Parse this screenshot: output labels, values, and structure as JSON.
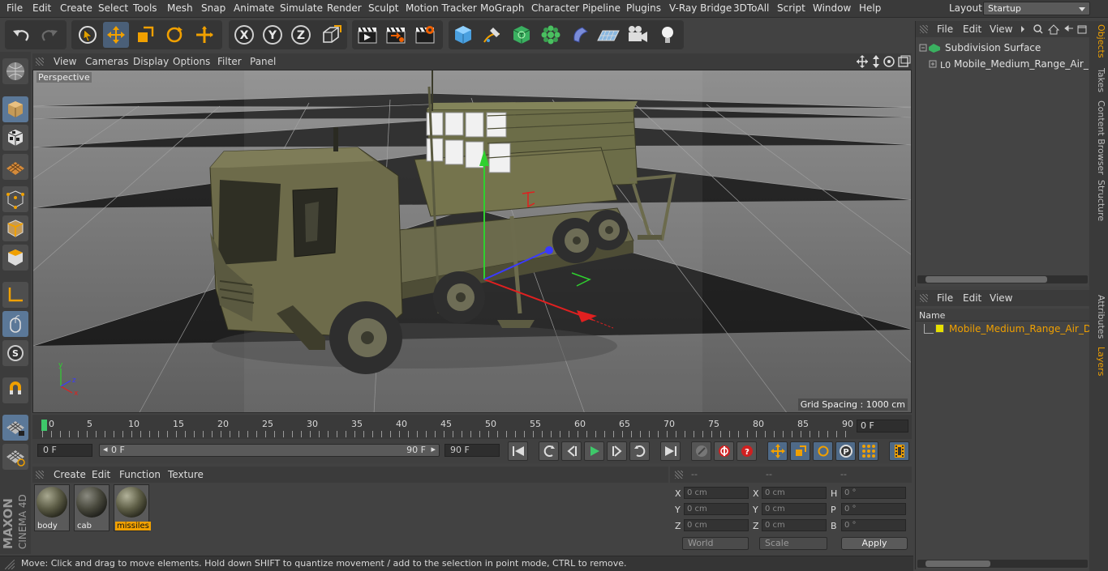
{
  "menu": [
    "File",
    "Edit",
    "Create",
    "Select",
    "Tools",
    "Mesh",
    "Snap",
    "Animate",
    "Simulate",
    "Render",
    "Sculpt",
    "Motion Tracker",
    "MoGraph",
    "Character",
    "Pipeline",
    "Plugins",
    "V-Ray Bridge",
    "3DToAll",
    "Script",
    "Window",
    "Help"
  ],
  "layout": {
    "label": "Layout:",
    "value": "Startup"
  },
  "toolbar": {
    "x_label": "X",
    "y_label": "Y",
    "z_label": "Z"
  },
  "viewport": {
    "menu": [
      "View",
      "Cameras",
      "Display",
      "Options",
      "Filter",
      "Panel"
    ],
    "camera_label": "Perspective",
    "grid_spacing": "Grid Spacing : 1000 cm"
  },
  "timeline": {
    "ticks": [
      "0",
      "5",
      "10",
      "15",
      "20",
      "25",
      "30",
      "35",
      "40",
      "45",
      "50",
      "55",
      "60",
      "65",
      "70",
      "75",
      "80",
      "85",
      "90"
    ],
    "current_frame": "0 F"
  },
  "transport": {
    "start": "0 F",
    "range_start": "0 F",
    "range_end": "90 F",
    "end": "90 F"
  },
  "materials": {
    "menu": [
      "Create",
      "Edit",
      "Function",
      "Texture"
    ],
    "items": [
      {
        "name": "body",
        "selected": false
      },
      {
        "name": "cab",
        "selected": false
      },
      {
        "name": "missiles",
        "selected": true
      }
    ]
  },
  "coords": {
    "headers": [
      "--",
      "--",
      "--"
    ],
    "rows": [
      {
        "a": "X",
        "av": "0 cm",
        "b": "X",
        "bv": "0 cm",
        "c": "H",
        "cv": "0 °"
      },
      {
        "a": "Y",
        "av": "0 cm",
        "b": "Y",
        "bv": "0 cm",
        "c": "P",
        "cv": "0 °"
      },
      {
        "a": "Z",
        "av": "0 cm",
        "b": "Z",
        "bv": "0 cm",
        "c": "B",
        "cv": "0 °"
      }
    ],
    "mode": "World",
    "size_mode": "Scale",
    "apply": "Apply"
  },
  "status": "Move: Click and drag to move elements. Hold down SHIFT to quantize movement / add to the selection in point mode, CTRL to remove.",
  "objects": {
    "menu": [
      "File",
      "Edit",
      "View"
    ],
    "items": [
      "Subdivision Surface",
      "Mobile_Medium_Range_Air_Defe"
    ]
  },
  "layers": {
    "menu": [
      "File",
      "Edit",
      "View"
    ],
    "column": "Name",
    "items": [
      "Mobile_Medium_Range_Air_Defer"
    ]
  },
  "side_tabs": [
    "Objects",
    "Takes",
    "Content Browser",
    "Structure",
    "Attributes",
    "Layers"
  ],
  "brand": {
    "line1": "MAXON",
    "line2": "CINEMA 4D"
  },
  "colors": {
    "accent": "#f0a000",
    "selection": "#4f6a88",
    "layer_color": "#e6e000"
  }
}
